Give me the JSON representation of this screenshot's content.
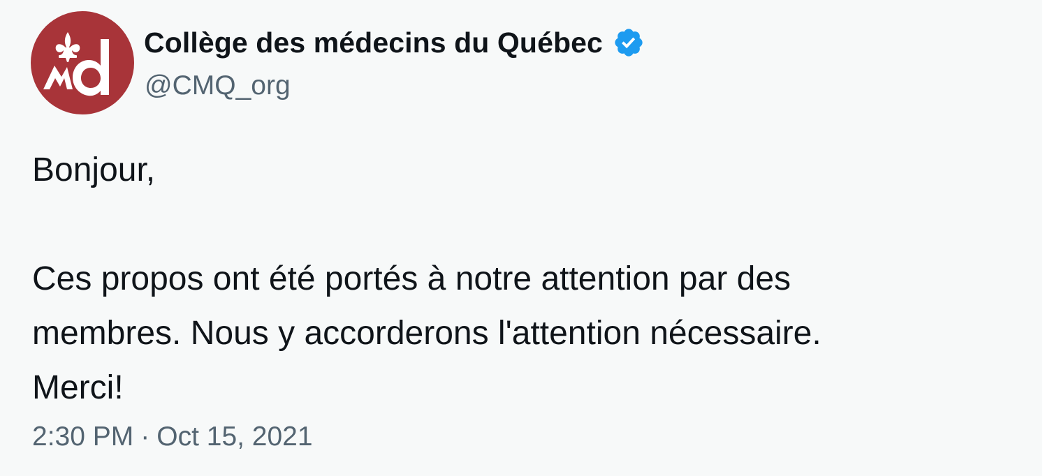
{
  "author": {
    "display_name": "Collège des médecins du Québec",
    "handle": "@CMQ_org",
    "verified": true,
    "avatar_logo_text": "md",
    "avatar_color": "#a83439",
    "verified_color": "#1d9bf0"
  },
  "tweet": {
    "greeting": "Bonjour,",
    "body_lines": [
      "Ces propos ont été portés à notre attention par des",
      "membres. Nous y accorderons l'attention nécessaire.",
      "Merci!"
    ]
  },
  "meta": {
    "time": "2:30 PM",
    "separator": "·",
    "date": "Oct 15, 2021"
  },
  "colors": {
    "text_primary": "#0f1419",
    "text_secondary": "#536471",
    "background": "#f7f9f9"
  }
}
